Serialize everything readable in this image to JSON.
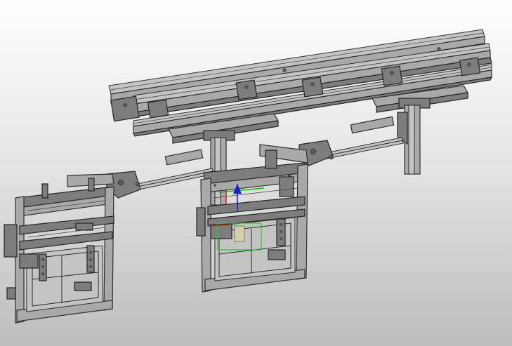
{
  "scene": {
    "background_top": "#ffffff",
    "background_bottom": "#bdbdbd",
    "metal_color": "#a9a9a9",
    "edge_color": "#2a2a2a"
  },
  "gizmo": {
    "x_axis_color": "#e02020",
    "y_axis_color": "#18b418",
    "z_axis_color": "#1a1ad8",
    "selection_color": "#2bc82b"
  }
}
